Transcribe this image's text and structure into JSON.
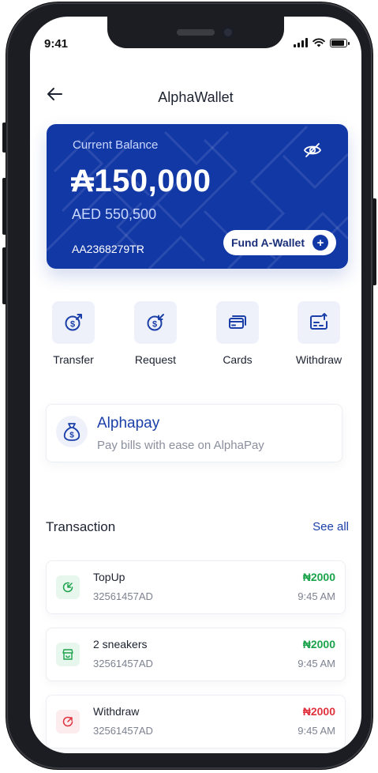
{
  "status_bar": {
    "time": "9:41"
  },
  "header": {
    "title": "AlphaWallet"
  },
  "balance_card": {
    "label": "Current Balance",
    "amount": "₳150,000",
    "secondary_amount": "AED 550,500",
    "account_id": "AA2368279TR",
    "fund_button_label": "Fund A-Wallet",
    "color": "#1238a6"
  },
  "actions": [
    {
      "label": "Transfer",
      "icon": "transfer-icon"
    },
    {
      "label": "Request",
      "icon": "request-icon"
    },
    {
      "label": "Cards",
      "icon": "cards-icon"
    },
    {
      "label": "Withdraw",
      "icon": "withdraw-icon"
    }
  ],
  "alphapay": {
    "title": "Alphapay",
    "subtitle": "Pay bills with ease on AlphaPay",
    "icon": "money-bag-icon"
  },
  "transactions": {
    "heading": "Transaction",
    "see_all": "See all",
    "items": [
      {
        "name": "TopUp",
        "ref": "32561457AD",
        "amount": "₦2000",
        "time": "9:45 AM",
        "type": "credit",
        "color": "#1aa34a"
      },
      {
        "name": "2 sneakers",
        "ref": "32561457AD",
        "amount": "₦2000",
        "time": "9:45 AM",
        "type": "credit",
        "color": "#1aa34a"
      },
      {
        "name": "Withdraw",
        "ref": "32561457AD",
        "amount": "₦2000",
        "time": "9:45 AM",
        "type": "debit",
        "color": "#e0323e"
      }
    ]
  }
}
